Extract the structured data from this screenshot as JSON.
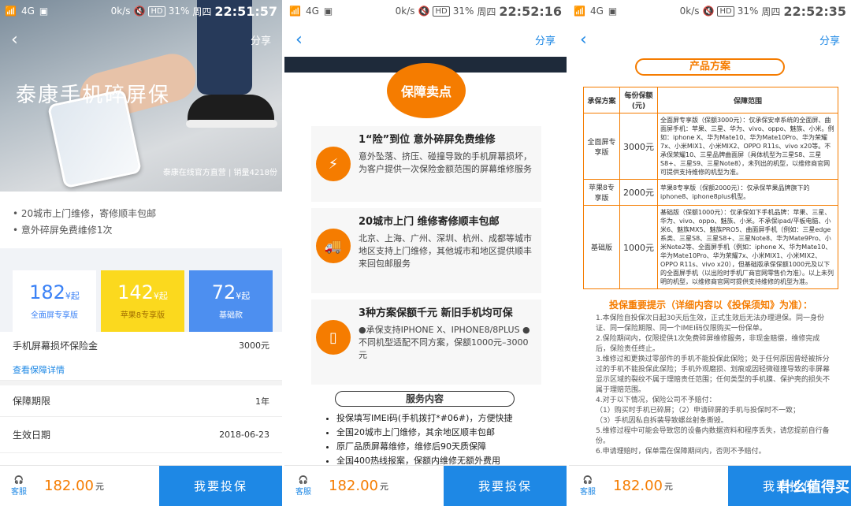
{
  "status": {
    "p1": {
      "speed": "0k/s",
      "battery": "31%",
      "day": "周四",
      "time": "22:51:57"
    },
    "p2": {
      "speed": "0k/s",
      "battery": "31%",
      "day": "周四",
      "time": "22:52:16"
    },
    "p3": {
      "speed": "0k/s",
      "battery": "31%",
      "day": "周四",
      "time": "22:52:35"
    }
  },
  "nav": {
    "back": "‹",
    "share": "分享"
  },
  "p1": {
    "hero_title": "泰康手机碎屏保",
    "hero_sub": "泰康在线官方直营 | 销量4218份",
    "features": [
      "20城市上门维修，寄修顺丰包邮",
      "意外碎屏免费维修1次"
    ],
    "plans": [
      {
        "price": "182",
        "unit": "¥起",
        "name": "全面屏专享版"
      },
      {
        "price": "142",
        "unit": "¥起",
        "name": "苹果8专享版"
      },
      {
        "price": "72",
        "unit": "¥起",
        "name": "基础款"
      }
    ],
    "coverage_label": "手机屏幕损坏保险金",
    "coverage_value": "3000元",
    "detail_link": "查看保障详情",
    "period_label": "保障期限",
    "period_value": "1年",
    "effective_label": "生效日期",
    "effective_value": "2018-06-23"
  },
  "p2": {
    "banner": "保障卖点",
    "cards": [
      {
        "title": "1“险”到位 意外碎屏免费维修",
        "text": "意外坠落、挤压、碰撞导致的手机屏幕损坏，为客户提供一次保险金额范围的屏幕维修服务"
      },
      {
        "title": "20城市上门 维修寄修顺丰包邮",
        "text": "北京、上海、广州、深圳、杭州、成都等城市地区支持上门维修，其他城市和地区提供顺丰来回包邮服务"
      },
      {
        "title": "3种方案保额千元 新旧手机均可保",
        "text": "●承保支持IPHONE X、IPHONE8/8PLUS ●不同机型适配不同方案，保额1000元–3000元"
      }
    ],
    "service_title": "服务内容",
    "services": [
      "投保填写IMEI码(手机拨打*#06#)，方便快捷",
      "全国20城市上门维修，其余地区顺丰包邮",
      "原厂品质屏幕维修，维修后90天质保障",
      "全国400热线报案，保额内维修无额外费用"
    ]
  },
  "p3": {
    "title": "产品方案",
    "headers": [
      "承保方案",
      "每份保额(元)",
      "保障范围"
    ],
    "rows": [
      {
        "name": "全面屏专享版",
        "amount": "3000元",
        "scope": "全面屏专享版（保额3000元）：仅承保安卓系统的全面屏、曲面屏手机：苹果、三星、华为、vivo、oppo、魅族、小米。例如：iphone X、华为Mate10、华为Mate10Pro、华为荣耀7x、小米MIX1、小米MIX2、OPPO R11s、vivo x20等。不承保荣耀10、三星品牌曲面屏（具体机型为三星S8、三星S8+、三星S9、三星Note8），未列出的机型，以维修商官网可提供支持维修的机型为准。"
      },
      {
        "name": "苹果8专享版",
        "amount": "2000元",
        "scope": "苹果8专享版（保额2000元）：仅承保苹果品牌旗下的iphone8、iphone8plus机型。"
      },
      {
        "name": "基础版",
        "amount": "1000元",
        "scope": "基础版（保额1000元）：仅承保如下手机品牌：苹果、三星、华为、vivo、oppo、魅族、小米。不承保ipad/平板电脑、小米6、魅族MX5、魅族PRO5、曲面屏手机（例如：三星edge系类、三星S8、三星S8+、三星Note8、华为Mate9Pro、小米Note2等、全面屏手机（例如：iphone X、华为Mate10、华为Mate10Pro、华为荣耀7x、小米MIX1、小米MIX2、OPPO R11s、vivo x20），但基础版承保保额1000元及以下的全面屏手机（以出险时手机厂商官网零售价为准）。以上未列明的机型，以维修商官网可提供支持维修的机型为准。"
      }
    ],
    "notice_title": "投保重要提示（详细内容以《投保须知》为准）：",
    "notices": [
      "1.本保险自投保次日起30天后生效，正式生效后无法办理退保。同一身份证、同一保险期限、同一个IMEI码仅限购买一份保单。",
      "2.保险期间内，仅限提供1次免费碎屏维修服务，非现金赔偿，维修完成后，保险责任终止。",
      "3.维修过和更换过零部件的手机不能投保此保险；处于任何原因曾经被拆分过的手机不能投保此保险；手机外观磨损、划痕或因轻微碰撞导致的非屏幕显示区域的裂纹不属于理赔责任范围；任何类型的手机膜、保护壳的损失不属于理赔范围。",
      "4.对于以下情况，保险公司不予赔付：",
      "（1）购买时手机已碎屏；（2）申请碎屏的手机与投保时不一致；",
      "（3）手机因私自拆装导致螺丝射条撕毁。",
      "5.维修过程中可能会导致您的设备内数据资料和程序丢失，请您提前自行备份。",
      "6.申请理赔时，保单需在保障期间内，否则不予赔付。"
    ]
  },
  "footer": {
    "service": "客服",
    "price": "182.00",
    "unit": "元",
    "buy": "我要投保"
  },
  "logo": "什么值得买"
}
